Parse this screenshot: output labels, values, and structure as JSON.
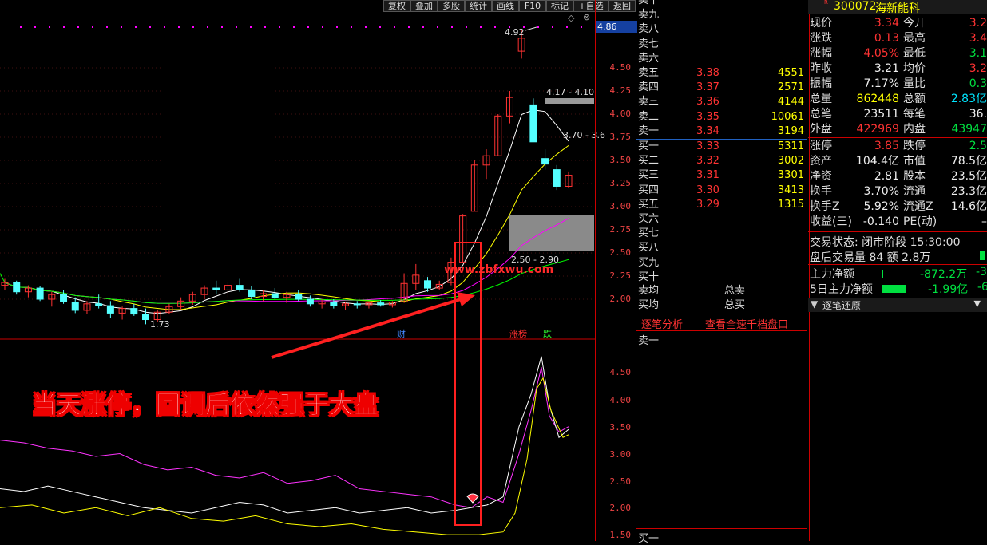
{
  "toolbar": {
    "items": [
      "复权",
      "叠加",
      "多股",
      "统计",
      "画线",
      "F10",
      "标记",
      "+自选",
      "返回"
    ]
  },
  "price_axis": {
    "current_price_tag": "4.86",
    "main_labels": [
      "4.50",
      "4.25",
      "4.00",
      "3.75",
      "3.50",
      "3.25",
      "3.00",
      "2.75",
      "2.50",
      "2.25",
      "2.00"
    ],
    "sub_labels": [
      "4.50",
      "4.00",
      "3.50",
      "3.00",
      "2.50",
      "2.00",
      "1.50"
    ]
  },
  "chart_annotations": {
    "high_label": "4.92",
    "box_label_1": "4.17 - 4.10",
    "box_label_2": "3.70 - 3.6",
    "box_label_3": "2.50 - 2.90",
    "low_label": "1.73",
    "watermark": "www.zbfxwu.com",
    "caption": "当天涨停，回调后依然强于大盘",
    "marker_cai": "财",
    "marker_zhangbang": "涨榜",
    "marker_die": "跌"
  },
  "chart_data": {
    "type": "line",
    "description_free": true,
    "candles": [
      {
        "o": 2.15,
        "h": 2.22,
        "l": 2.1,
        "c": 2.18
      },
      {
        "o": 2.18,
        "h": 2.2,
        "l": 2.05,
        "c": 2.08
      },
      {
        "o": 2.08,
        "h": 2.15,
        "l": 2.02,
        "c": 2.12
      },
      {
        "o": 2.12,
        "h": 2.14,
        "l": 1.98,
        "c": 2.0
      },
      {
        "o": 2.0,
        "h": 2.08,
        "l": 1.92,
        "c": 2.05
      },
      {
        "o": 2.05,
        "h": 2.1,
        "l": 1.95,
        "c": 1.97
      },
      {
        "o": 1.97,
        "h": 2.02,
        "l": 1.85,
        "c": 1.88
      },
      {
        "o": 1.88,
        "h": 1.98,
        "l": 1.84,
        "c": 1.95
      },
      {
        "o": 1.95,
        "h": 2.05,
        "l": 1.9,
        "c": 1.93
      },
      {
        "o": 1.93,
        "h": 1.98,
        "l": 1.8,
        "c": 1.85
      },
      {
        "o": 1.85,
        "h": 1.92,
        "l": 1.78,
        "c": 1.9
      },
      {
        "o": 1.9,
        "h": 1.95,
        "l": 1.82,
        "c": 1.84
      },
      {
        "o": 1.84,
        "h": 1.9,
        "l": 1.73,
        "c": 1.78
      },
      {
        "o": 1.78,
        "h": 1.88,
        "l": 1.75,
        "c": 1.86
      },
      {
        "o": 1.86,
        "h": 1.95,
        "l": 1.84,
        "c": 1.92
      },
      {
        "o": 1.92,
        "h": 2.02,
        "l": 1.88,
        "c": 1.98
      },
      {
        "o": 1.98,
        "h": 2.08,
        "l": 1.94,
        "c": 2.05
      },
      {
        "o": 2.05,
        "h": 2.15,
        "l": 2.0,
        "c": 2.12
      },
      {
        "o": 2.12,
        "h": 2.2,
        "l": 2.06,
        "c": 2.1
      },
      {
        "o": 2.1,
        "h": 2.18,
        "l": 2.02,
        "c": 2.15
      },
      {
        "o": 2.15,
        "h": 2.22,
        "l": 2.08,
        "c": 2.1
      },
      {
        "o": 2.1,
        "h": 2.14,
        "l": 2.0,
        "c": 2.03
      },
      {
        "o": 2.03,
        "h": 2.1,
        "l": 1.98,
        "c": 2.06
      },
      {
        "o": 2.06,
        "h": 2.12,
        "l": 2.0,
        "c": 2.02
      },
      {
        "o": 2.02,
        "h": 2.08,
        "l": 1.96,
        "c": 2.05
      },
      {
        "o": 2.05,
        "h": 2.1,
        "l": 1.98,
        "c": 2.0
      },
      {
        "o": 2.0,
        "h": 2.04,
        "l": 1.92,
        "c": 1.95
      },
      {
        "o": 1.95,
        "h": 2.0,
        "l": 1.9,
        "c": 1.97
      },
      {
        "o": 1.97,
        "h": 2.0,
        "l": 1.9,
        "c": 1.93
      },
      {
        "o": 1.93,
        "h": 1.97,
        "l": 1.88,
        "c": 1.95
      },
      {
        "o": 1.95,
        "h": 1.98,
        "l": 1.9,
        "c": 1.94
      },
      {
        "o": 1.94,
        "h": 1.97,
        "l": 1.9,
        "c": 1.96
      },
      {
        "o": 1.96,
        "h": 1.99,
        "l": 1.92,
        "c": 1.94
      },
      {
        "o": 1.94,
        "h": 1.98,
        "l": 1.91,
        "c": 1.97
      },
      {
        "o": 1.97,
        "h": 2.28,
        "l": 1.96,
        "c": 2.17
      },
      {
        "o": 2.17,
        "h": 2.38,
        "l": 2.1,
        "c": 2.26
      },
      {
        "o": 2.2,
        "h": 2.24,
        "l": 2.08,
        "c": 2.12
      },
      {
        "o": 2.12,
        "h": 2.2,
        "l": 2.1,
        "c": 2.16
      },
      {
        "o": 2.18,
        "h": 2.45,
        "l": 2.15,
        "c": 2.4
      },
      {
        "o": 2.4,
        "h": 2.92,
        "l": 2.4,
        "c": 2.9
      },
      {
        "o": 2.95,
        "h": 3.5,
        "l": 2.95,
        "c": 3.45
      },
      {
        "o": 3.45,
        "h": 3.62,
        "l": 3.3,
        "c": 3.55
      },
      {
        "o": 3.55,
        "h": 4.0,
        "l": 3.55,
        "c": 3.98
      },
      {
        "o": 3.98,
        "h": 4.25,
        "l": 3.9,
        "c": 4.18
      },
      {
        "o": 4.68,
        "h": 4.92,
        "l": 4.6,
        "c": 4.82
      },
      {
        "o": 4.1,
        "h": 4.17,
        "l": 3.7,
        "c": 3.7
      },
      {
        "o": 3.52,
        "h": 3.62,
        "l": 3.4,
        "c": 3.46
      },
      {
        "o": 3.4,
        "h": 3.45,
        "l": 3.18,
        "c": 3.22
      },
      {
        "o": 3.22,
        "h": 3.38,
        "l": 3.2,
        "c": 3.34
      }
    ],
    "ylim": [
      1.9,
      4.95
    ]
  },
  "orderbook": {
    "sell_labels": [
      "卖十",
      "卖九",
      "卖八",
      "卖七",
      "卖六",
      "卖五",
      "卖四",
      "卖三",
      "卖二",
      "卖一"
    ],
    "sell_prices": [
      "",
      "",
      "",
      "",
      "",
      "3.38",
      "3.37",
      "3.36",
      "3.35",
      "3.34"
    ],
    "sell_vols": [
      "",
      "",
      "",
      "",
      "",
      "4551",
      "2571",
      "4144",
      "10061",
      "3194"
    ],
    "buy_labels": [
      "买一",
      "买二",
      "买三",
      "买四",
      "买五",
      "买六",
      "买七",
      "买八",
      "买九",
      "买十"
    ],
    "buy_prices": [
      "3.33",
      "3.32",
      "3.31",
      "3.30",
      "3.29",
      "",
      "",
      "",
      "",
      ""
    ],
    "buy_vols": [
      "5311",
      "3002",
      "3301",
      "3413",
      "1315",
      "",
      "",
      "",
      "",
      ""
    ],
    "avg_sell_label": "卖均",
    "avg_buy_label": "买均",
    "total_sell_label": "总卖",
    "total_buy_label": "总买",
    "btn_tick": "逐笔分析",
    "btn_depth": "查看全速千档盘口",
    "sell1_bottom": "卖一",
    "buy1_bottom": "买一"
  },
  "quote": {
    "code": "300072",
    "name": "海新能科",
    "rows": [
      {
        "k": "现价",
        "v": "3.34",
        "k2": "今开",
        "v2": "3.2"
      },
      {
        "k": "涨跌",
        "v": "0.13",
        "k2": "最高",
        "v2": "3.4"
      },
      {
        "k": "涨幅",
        "v": "4.05%",
        "k2": "最低",
        "v2": "3.1"
      },
      {
        "k": "昨收",
        "v": "3.21",
        "k2": "均价",
        "v2": "3.2"
      },
      {
        "k": "振幅",
        "v": "7.17%",
        "k2": "量比",
        "v2": "0.3"
      },
      {
        "k": "总量",
        "v": "862448",
        "k2": "总额",
        "v2": "2.83亿"
      },
      {
        "k": "总笔",
        "v": "23511",
        "k2": "每笔",
        "v2": "36."
      },
      {
        "k": "外盘",
        "v": "422969",
        "k2": "内盘",
        "v2": "43947"
      },
      {
        "k": "涨停",
        "v": "3.85",
        "k2": "跌停",
        "v2": "2.5"
      },
      {
        "k": "资产",
        "v": "104.4亿",
        "k2": "市值",
        "v2": "78.5亿"
      },
      {
        "k": "净资",
        "v": "2.81",
        "k2": "股本",
        "v2": "23.5亿"
      },
      {
        "k": "换手",
        "v": "3.70%",
        "k2": "流通",
        "v2": "23.3亿"
      },
      {
        "k": "换手Z",
        "v": "5.92%",
        "k2": "流通Z",
        "v2": "14.6亿"
      },
      {
        "k": "收益(三)",
        "v": "-0.140",
        "k2": "PE(动)",
        "v2": "–"
      }
    ],
    "status": "交易状态: 闭市阶段 15:30:00",
    "after_hours": "盘后交易量 84 额 2.8万",
    "main_net_label": "主力净额",
    "main_net_val": "-872.2万",
    "main_net_pct": "-3",
    "main5_label": "5日主力净额",
    "main5_val": "-1.99亿",
    "main5_pct": "-6",
    "tick_restore": "逐笔还原"
  }
}
